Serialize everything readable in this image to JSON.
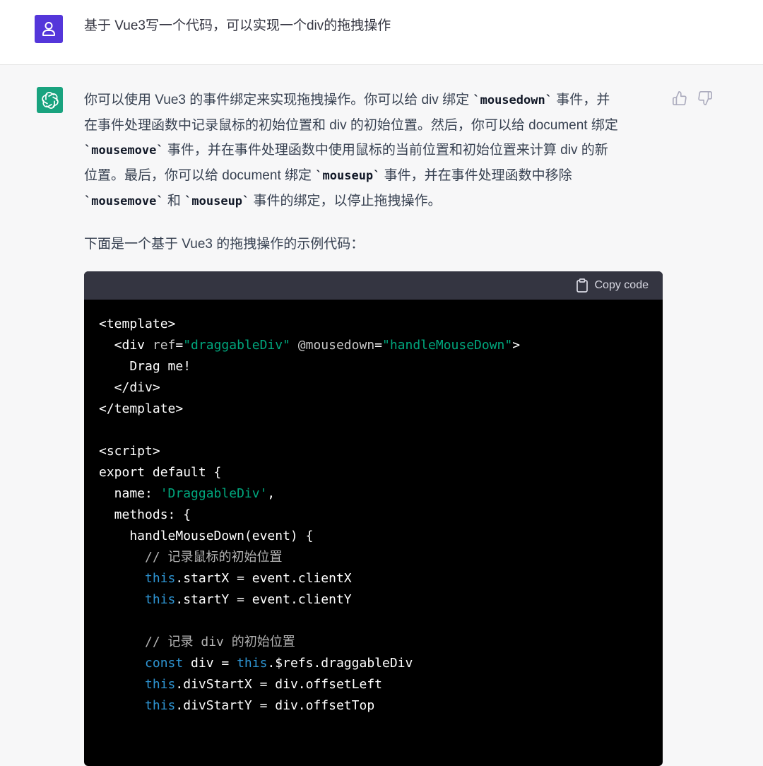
{
  "user": {
    "message": "基于 Vue3写一个代码，可以实现一个div的拖拽操作"
  },
  "assistant": {
    "para1_lines": [
      [
        {
          "t": "你可以使用 Vue3 的事件绑定来实现拖拽操作。你可以给 div 绑定 "
        },
        {
          "c": "`mousedown`"
        },
        {
          "t": " 事件，并"
        }
      ],
      [
        {
          "t": "在事件处理函数中记录鼠标的初始位置和 div 的初始位置。然后，你可以给 document 绑定"
        }
      ],
      [
        {
          "c": "`mousemove`"
        },
        {
          "t": " 事件，并在事件处理函数中使用鼠标的当前位置和初始位置来计算 div 的新"
        }
      ],
      [
        {
          "t": "位置。最后，你可以给 document 绑定 "
        },
        {
          "c": "`mouseup`"
        },
        {
          "t": " 事件，并在事件处理函数中移除"
        }
      ],
      [
        {
          "c": "`mousemove`"
        },
        {
          "t": " 和 "
        },
        {
          "c": "`mouseup`"
        },
        {
          "t": " 事件的绑定，以停止拖拽操作。"
        }
      ]
    ],
    "para2": "下面是一个基于 Vue3 的拖拽操作的示例代码：",
    "copy_label": "Copy code",
    "code_lines": [
      [
        {
          "t": "<template>"
        }
      ],
      [
        {
          "t": "  <div "
        },
        {
          "a": "ref"
        },
        {
          "t": "="
        },
        {
          "s": "\"draggableDiv\""
        },
        {
          "t": " "
        },
        {
          "a": "@mousedown"
        },
        {
          "t": "="
        },
        {
          "s": "\"handleMouseDown\""
        },
        {
          "t": ">"
        }
      ],
      [
        {
          "t": "    Drag me!"
        }
      ],
      [
        {
          "t": "  </div>"
        }
      ],
      [
        {
          "t": "</template>"
        }
      ],
      [
        {
          "t": ""
        }
      ],
      [
        {
          "t": "<script>"
        }
      ],
      [
        {
          "t": "export default {"
        }
      ],
      [
        {
          "t": "  name: "
        },
        {
          "s": "'DraggableDiv'"
        },
        {
          "t": ","
        }
      ],
      [
        {
          "t": "  methods: {"
        }
      ],
      [
        {
          "t": "    handleMouseDown(event) {"
        }
      ],
      [
        {
          "m": "      // 记录鼠标的初始位置"
        }
      ],
      [
        {
          "t": "      "
        },
        {
          "k": "this"
        },
        {
          "t": ".startX = event.clientX"
        }
      ],
      [
        {
          "t": "      "
        },
        {
          "k": "this"
        },
        {
          "t": ".startY = event.clientY"
        }
      ],
      [
        {
          "t": ""
        }
      ],
      [
        {
          "m": "      // 记录 div 的初始位置"
        }
      ],
      [
        {
          "t": "      "
        },
        {
          "k": "const"
        },
        {
          "t": " div = "
        },
        {
          "k": "this"
        },
        {
          "t": ".$refs.draggableDiv"
        }
      ],
      [
        {
          "t": "      "
        },
        {
          "k": "this"
        },
        {
          "t": ".divStartX = div.offsetLeft"
        }
      ],
      [
        {
          "t": "      "
        },
        {
          "k": "this"
        },
        {
          "t": ".divStartY = div.offsetTop"
        }
      ]
    ]
  }
}
